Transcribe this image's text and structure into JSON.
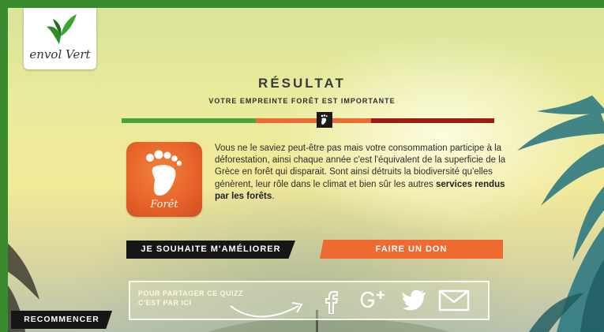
{
  "colors": {
    "frame_green": "#3a8a2e",
    "meter_green": "#4aa33a",
    "meter_orange": "#ec6a33",
    "meter_red": "#9b1d14",
    "accent_orange": "#ef6a31",
    "button_dark": "#161616"
  },
  "logo": {
    "text": "envol Vert",
    "icon": "butterfly-leaf-icon"
  },
  "result": {
    "title": "RÉSULTAT",
    "subtitle": "VOTRE EMPREINTE FORÊT EST IMPORTANTE",
    "marker_icon": "footprint-icon"
  },
  "app_icon": {
    "label": "Forêt",
    "icon": "footprint-icon"
  },
  "message": {
    "text": "Vous ne le saviez peut-être pas mais votre consommation participe à la déforestation, ainsi chaque année c'est l'équivalent de la superficie de la Grèce en forêt qui disparait. Sont ainsi détruits la biodiversité qu'elles génèrent, leur rôle dans le climat et bien sûr les autres ",
    "bold": "services rendus par les forêts",
    "end": "."
  },
  "buttons": {
    "improve": "JE SOUHAITE M'AMÉLIORER",
    "donate": "FAIRE UN DON",
    "restart": "RECOMMENCER"
  },
  "share": {
    "line1": "POUR PARTAGER CE QUIZZ",
    "line2": "C'EST PAR ICI",
    "icons": [
      "facebook-icon",
      "google-plus-icon",
      "twitter-icon",
      "mail-icon"
    ]
  }
}
